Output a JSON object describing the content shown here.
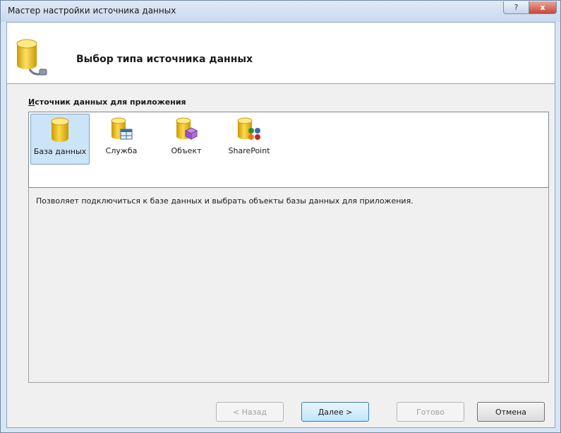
{
  "window": {
    "title": "Мастер настройки источника данных",
    "help_label": "?",
    "close_label": "x"
  },
  "header": {
    "title": "Выбор типа источника данных",
    "icon": "database-plug-icon"
  },
  "section": {
    "label_accel": "И",
    "label_rest": "сточник данных для приложения"
  },
  "source_types": [
    {
      "label": "База данных",
      "icon": "database-icon",
      "selected": true
    },
    {
      "label": "Служба",
      "icon": "service-icon",
      "selected": false
    },
    {
      "label": "Объект",
      "icon": "object-icon",
      "selected": false
    },
    {
      "label": "SharePoint",
      "icon": "sharepoint-icon",
      "selected": false
    }
  ],
  "description": "Позволяет подключиться к базе данных и выбрать объекты базы данных для приложения.",
  "buttons": {
    "back": "< Назад",
    "next": "Далее >",
    "finish": "Готово",
    "cancel": "Отмена"
  },
  "colors": {
    "selection": "#cce4f7",
    "cylinder_gold": "#e8b800",
    "title_bar": "#c9d9ee"
  }
}
